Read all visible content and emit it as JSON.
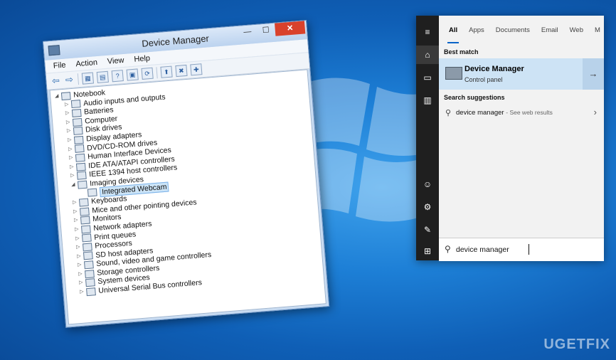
{
  "device_manager": {
    "title": "Device Manager",
    "menu": [
      "File",
      "Action",
      "View",
      "Help"
    ],
    "tree": [
      {
        "label": "Notebook",
        "level": 0,
        "expander": "◢"
      },
      {
        "label": "Audio inputs and outputs",
        "level": 1,
        "expander": "▷"
      },
      {
        "label": "Batteries",
        "level": 1,
        "expander": "▷"
      },
      {
        "label": "Computer",
        "level": 1,
        "expander": "▷"
      },
      {
        "label": "Disk drives",
        "level": 1,
        "expander": "▷"
      },
      {
        "label": "Display adapters",
        "level": 1,
        "expander": "▷"
      },
      {
        "label": "DVD/CD-ROM drives",
        "level": 1,
        "expander": "▷"
      },
      {
        "label": "Human Interface Devices",
        "level": 1,
        "expander": "▷"
      },
      {
        "label": "IDE ATA/ATAPI controllers",
        "level": 1,
        "expander": "▷"
      },
      {
        "label": "IEEE 1394 host controllers",
        "level": 1,
        "expander": "▷"
      },
      {
        "label": "Imaging devices",
        "level": 1,
        "expander": "◢"
      },
      {
        "label": "Integrated Webcam",
        "level": 2,
        "expander": "",
        "selected": true
      },
      {
        "label": "Keyboards",
        "level": 1,
        "expander": "▷"
      },
      {
        "label": "Mice and other pointing devices",
        "level": 1,
        "expander": "▷"
      },
      {
        "label": "Monitors",
        "level": 1,
        "expander": "▷"
      },
      {
        "label": "Network adapters",
        "level": 1,
        "expander": "▷"
      },
      {
        "label": "Print queues",
        "level": 1,
        "expander": "▷"
      },
      {
        "label": "Processors",
        "level": 1,
        "expander": "▷"
      },
      {
        "label": "SD host adapters",
        "level": 1,
        "expander": "▷"
      },
      {
        "label": "Sound, video and game controllers",
        "level": 1,
        "expander": "▷"
      },
      {
        "label": "Storage controllers",
        "level": 1,
        "expander": "▷"
      },
      {
        "label": "System devices",
        "level": 1,
        "expander": "▷"
      },
      {
        "label": "Universal Serial Bus controllers",
        "level": 1,
        "expander": "▷"
      }
    ]
  },
  "search_panel": {
    "tabs": [
      "All",
      "Apps",
      "Documents",
      "Email",
      "Web",
      "M"
    ],
    "best_match_heading": "Best match",
    "best_match": {
      "title": "Device Manager",
      "subtitle": "Control panel"
    },
    "suggestions_heading": "Search suggestions",
    "suggestion": {
      "query": "device manager",
      "hint": "- See web results"
    },
    "query": "device manager",
    "rail_icons": [
      "hamburger-icon",
      "home-icon",
      "documents-icon",
      "building-icon",
      "user-icon",
      "settings-icon",
      "feedback-icon",
      "windows-start-icon"
    ]
  },
  "watermark": "UGETFIX",
  "colors": {
    "desktop": "#1d7fd6",
    "accent": "#0a64c8",
    "selection": "#cde3f5",
    "close": "#d9412b"
  }
}
